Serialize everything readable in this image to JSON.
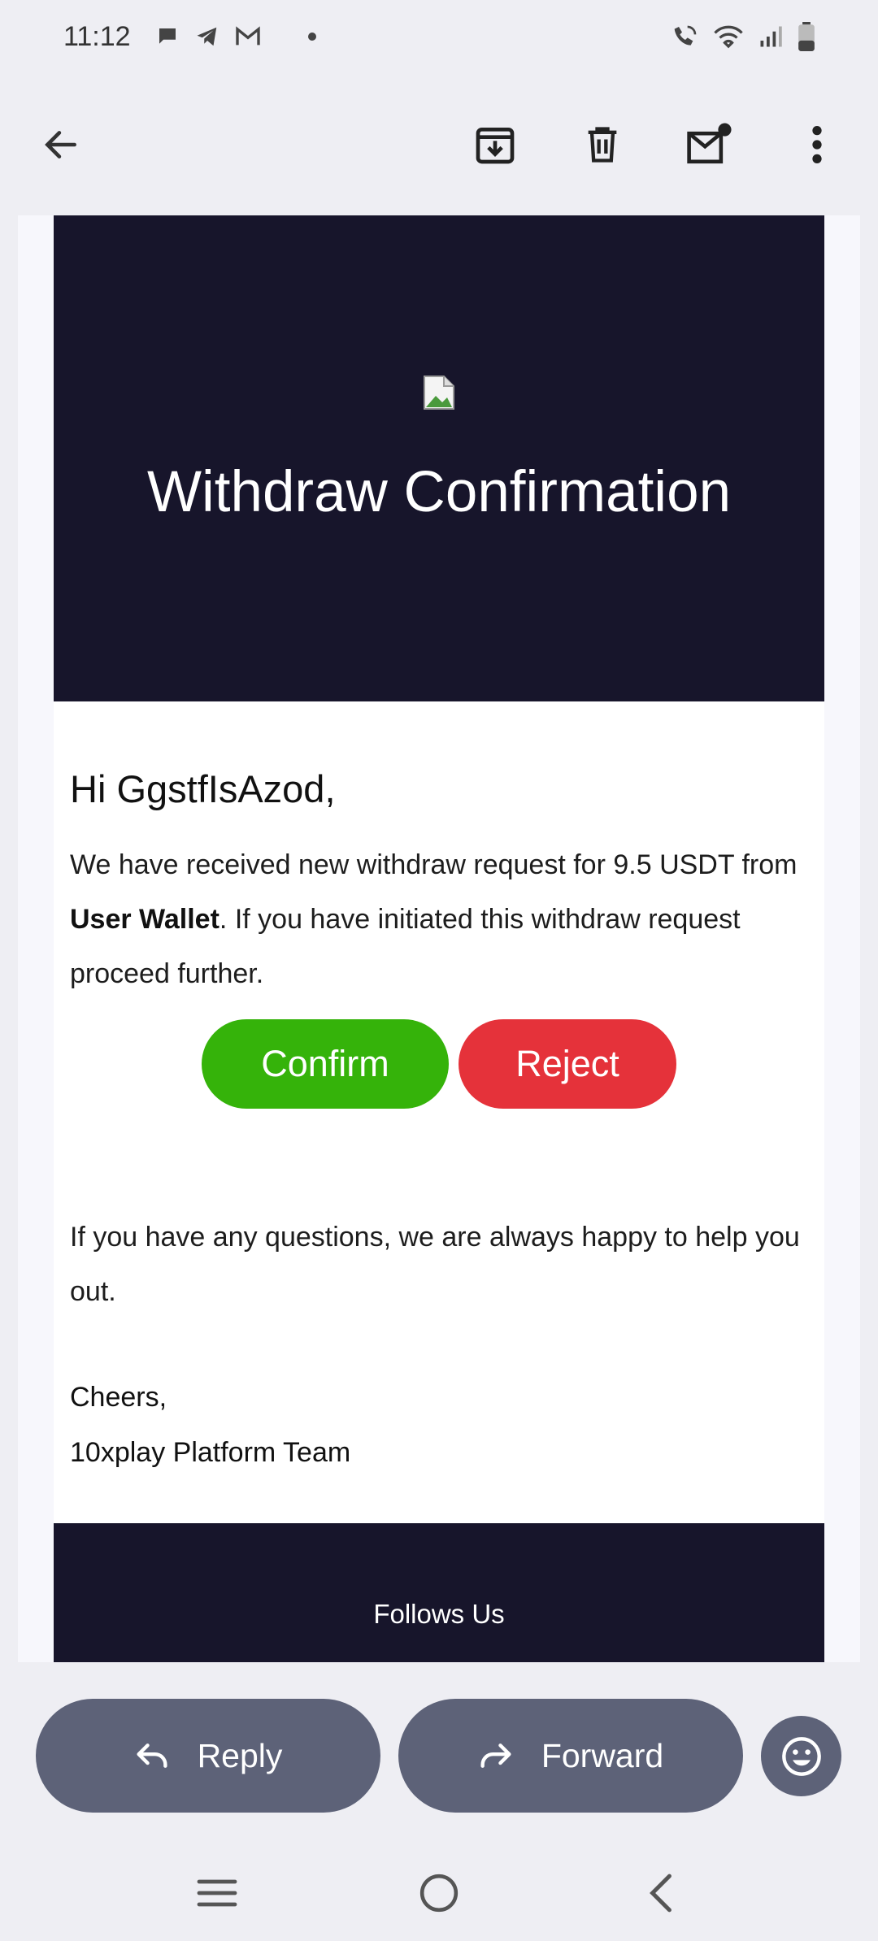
{
  "status_bar": {
    "time": "11:12",
    "left_icons": [
      "chat-bubble-icon",
      "telegram-icon",
      "gmail-icon"
    ],
    "right_icons": [
      "wifi-call-icon",
      "wifi-icon",
      "signal-icon",
      "battery-icon"
    ]
  },
  "toolbar": {
    "icons": [
      "back-arrow-icon",
      "archive-icon",
      "delete-icon",
      "mark-unread-icon",
      "more-vert-icon"
    ]
  },
  "email": {
    "hero_title": "Withdraw Confirmation",
    "greeting": "Hi GgstfIsAzod,",
    "message_part1": "We have received new withdraw request for 9.5 USDT from ",
    "message_bold": "User Wallet",
    "message_part2": ". If you have initiated this withdraw request proceed further.",
    "confirm_label": "Confirm",
    "reject_label": "Reject",
    "help_text": "If you have any questions, we are always happy to help you out.",
    "signoff_line1": "Cheers,",
    "signoff_line2": "10xplay Platform Team",
    "footer_title": "Follows Us",
    "colors": {
      "hero_bg": "#17152b",
      "confirm": "#35b30a",
      "reject": "#e5323a"
    }
  },
  "actions": {
    "reply_label": "Reply",
    "forward_label": "Forward",
    "emoji_icon": "emoji-smile-icon",
    "button_color": "#5d6278"
  },
  "nav_bar": {
    "icons": [
      "recents-icon",
      "home-icon",
      "back-icon"
    ]
  }
}
